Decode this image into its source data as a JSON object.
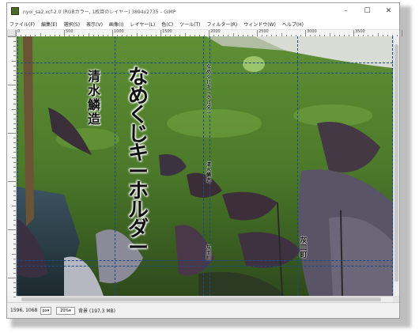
{
  "window": {
    "title": "nyoi_sa2.xcf-2.0 (RGBカラー, 1枚目のレイヤー) 3894x2735 – GIMP",
    "buttons": [
      "–",
      "☐",
      "✕"
    ]
  },
  "menu": [
    "ファイル(F)",
    "編集(E)",
    "選択(S)",
    "表示(V)",
    "画像(I)",
    "レイヤー(L)",
    "色(C)",
    "ツール(T)",
    "フィルター(R)",
    "ウィンドウ(W)",
    "ヘルプ(H)"
  ],
  "ruler": {
    "labels": [
      "0",
      "500",
      "1000",
      "1500",
      "2000",
      "2500",
      "3000",
      "3500"
    ]
  },
  "canvas": {
    "main_text": "なめくじキーホルダー",
    "name_text": "清水鱗造",
    "small_text_1": "なめくじキーホルダー",
    "small_text_2": "清水鱗造",
    "small_text_3": "灰皿町",
    "side_text": "灰皿町"
  },
  "status": {
    "coords": "1596, 1068",
    "unit": "px",
    "zoom": "20%",
    "message": "背景 (197.3 MB)"
  },
  "colors": {
    "guide": "#1a4a8a",
    "grass": "#4f7a2c",
    "leaf_dark": "#3a2f38"
  },
  "icons": {
    "app": "gimp-icon",
    "unit_dropdown": "chevron-down-icon",
    "zoom_dropdown": "chevron-down-icon"
  }
}
